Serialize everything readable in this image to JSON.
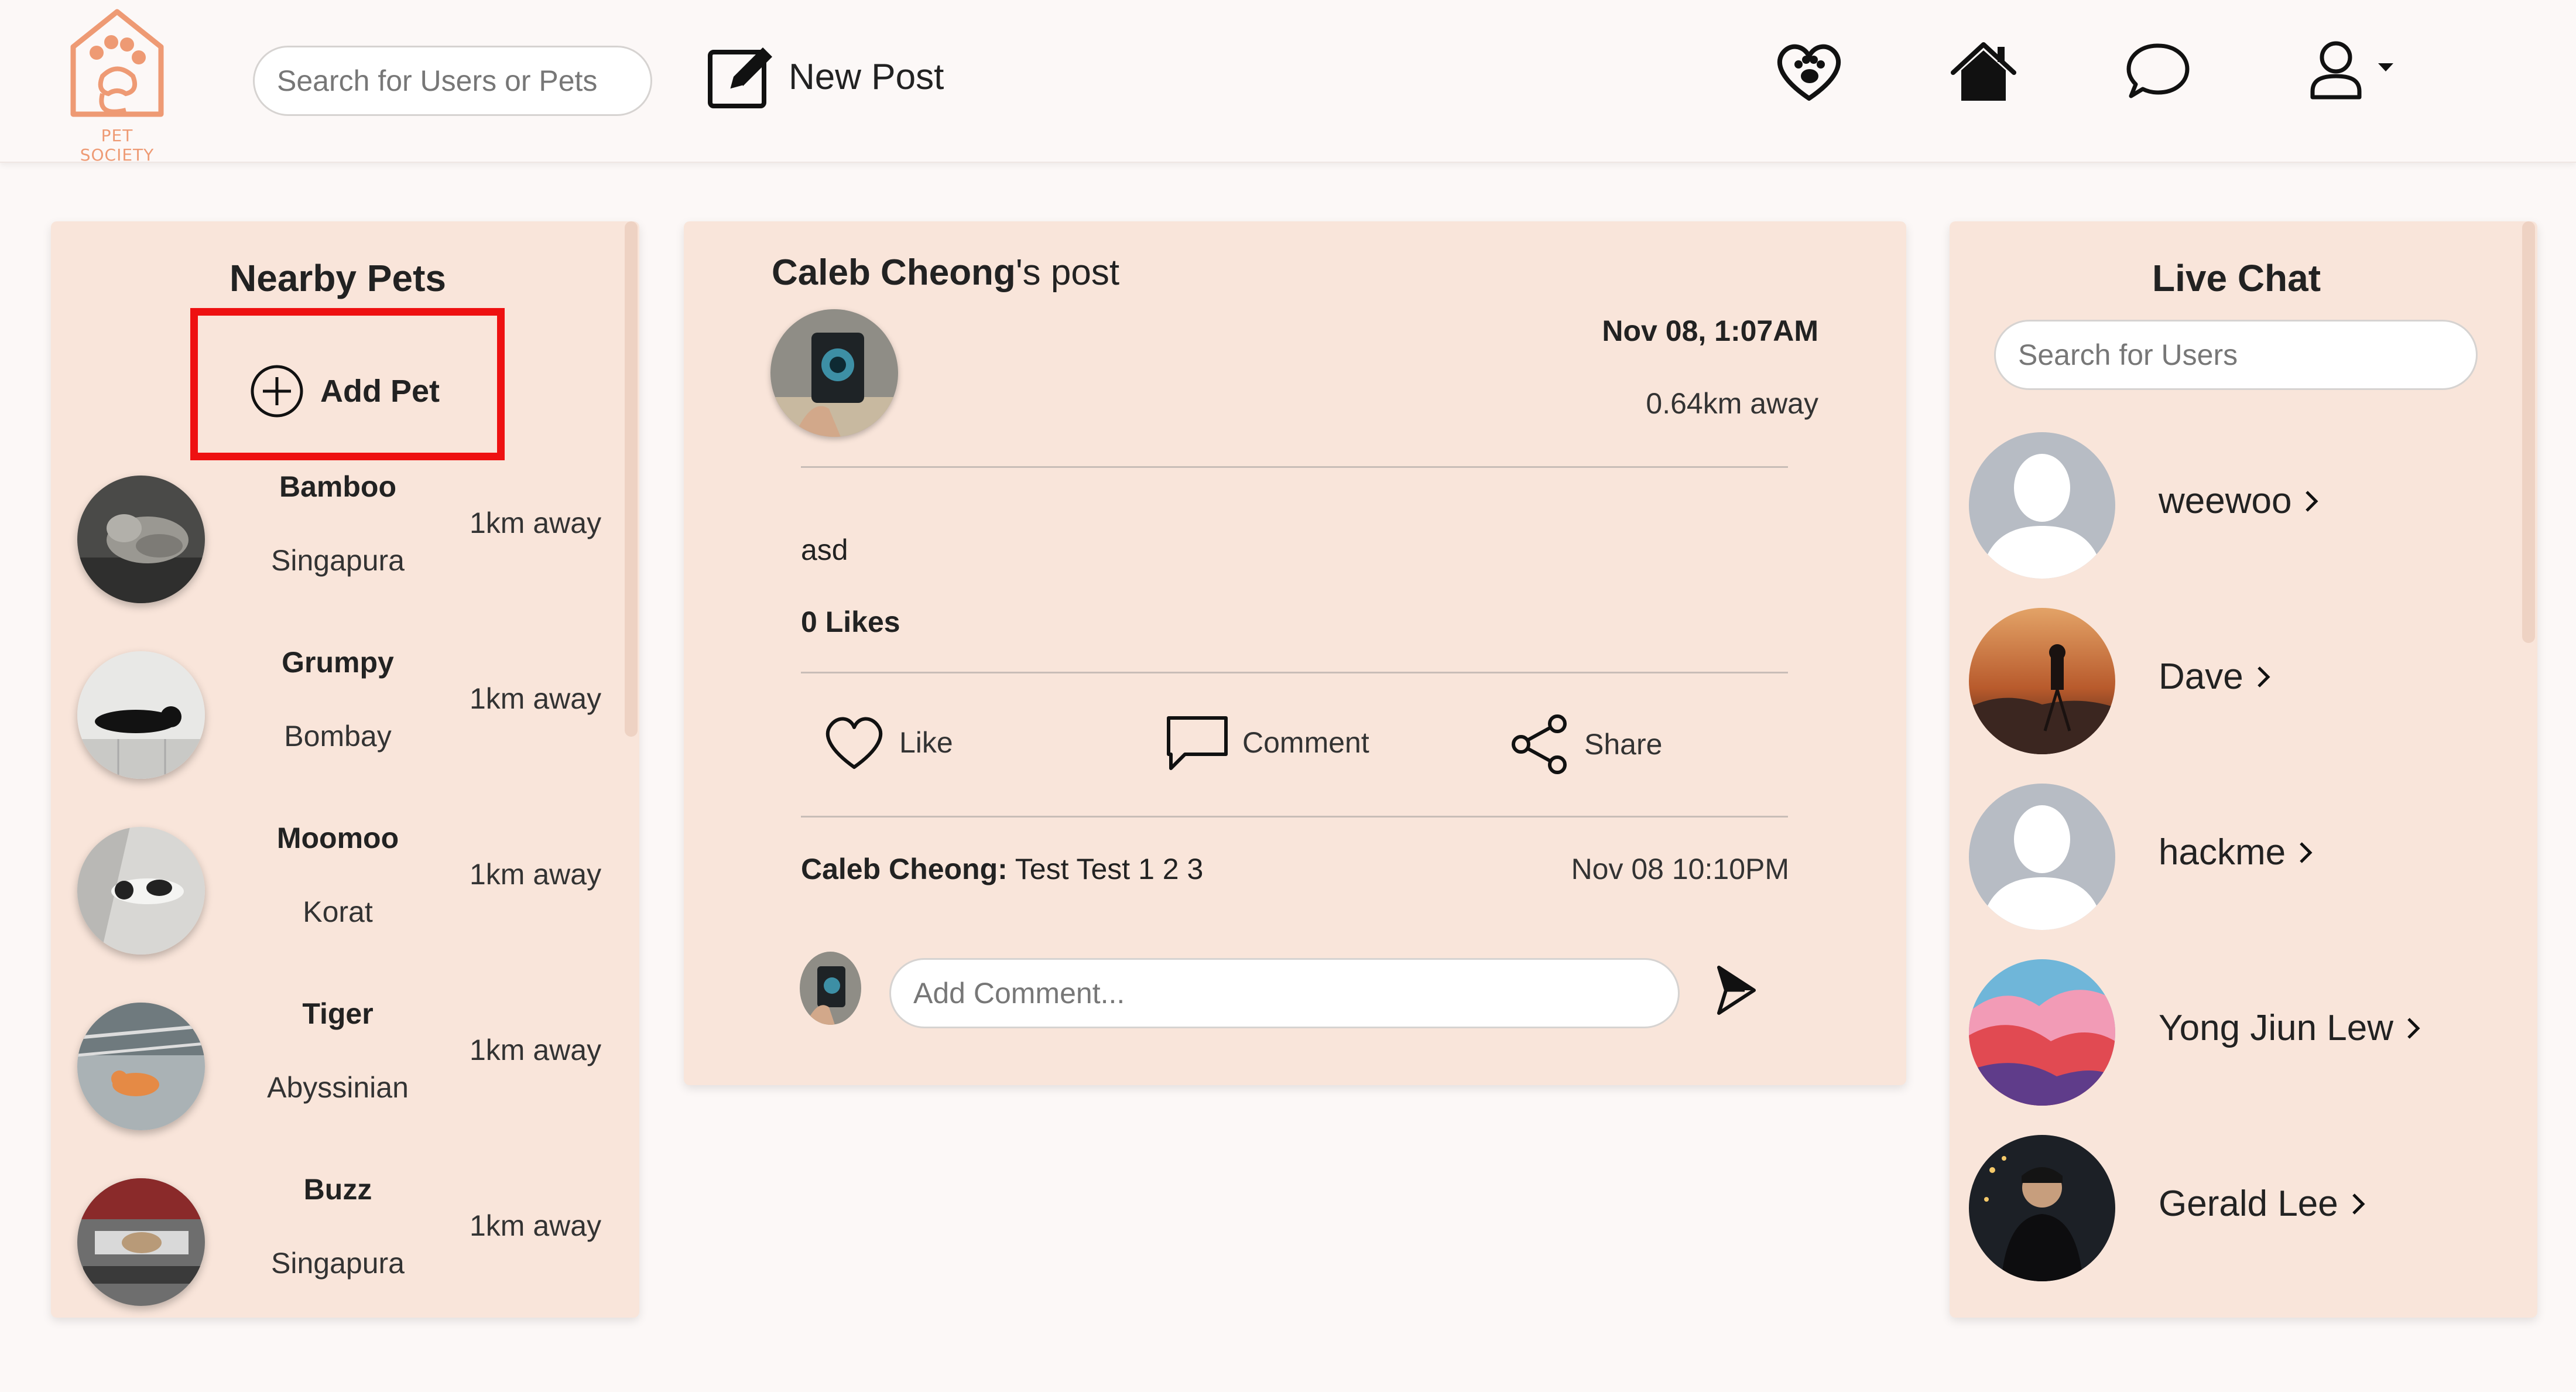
{
  "nav": {
    "logo_text": "PET SOCIETY",
    "search_placeholder": "Search for Users or Pets",
    "new_post_label": "New Post",
    "icons": [
      "paw-heart-icon",
      "home-icon",
      "chat-bubble-icon",
      "user-icon",
      "caret-down-icon"
    ]
  },
  "nearby": {
    "title": "Nearby Pets",
    "add_label": "Add Pet",
    "pets": [
      {
        "name": "Bamboo",
        "breed": "Singapura",
        "distance": "1km away"
      },
      {
        "name": "Grumpy",
        "breed": "Bombay",
        "distance": "1km away"
      },
      {
        "name": "Moomoo",
        "breed": "Korat",
        "distance": "1km away"
      },
      {
        "name": "Tiger",
        "breed": "Abyssinian",
        "distance": "1km away"
      },
      {
        "name": "Buzz",
        "breed": "Singapura",
        "distance": "1km away"
      }
    ]
  },
  "post": {
    "author": "Caleb Cheong",
    "title_suffix": "'s post",
    "date": "Nov 08, 1:07AM",
    "distance": "0.64km away",
    "body": "asd",
    "likes": "0 Likes",
    "actions": {
      "like": "Like",
      "comment": "Comment",
      "share": "Share"
    },
    "comment": {
      "author": "Caleb Cheong:",
      "text": " Test Test 1 2 3",
      "time": "Nov 08 10:10PM"
    },
    "comment_placeholder": "Add Comment..."
  },
  "chat": {
    "title": "Live Chat",
    "search_placeholder": "Search for Users",
    "users": [
      {
        "name": "weewoo"
      },
      {
        "name": "Dave"
      },
      {
        "name": "hackme"
      },
      {
        "name": "Yong Jiun Lew"
      },
      {
        "name": "Gerald Lee"
      }
    ]
  },
  "colors": {
    "panel": "#f9e5da",
    "brand": "#ee9a74",
    "highlight": "#ee1111"
  }
}
